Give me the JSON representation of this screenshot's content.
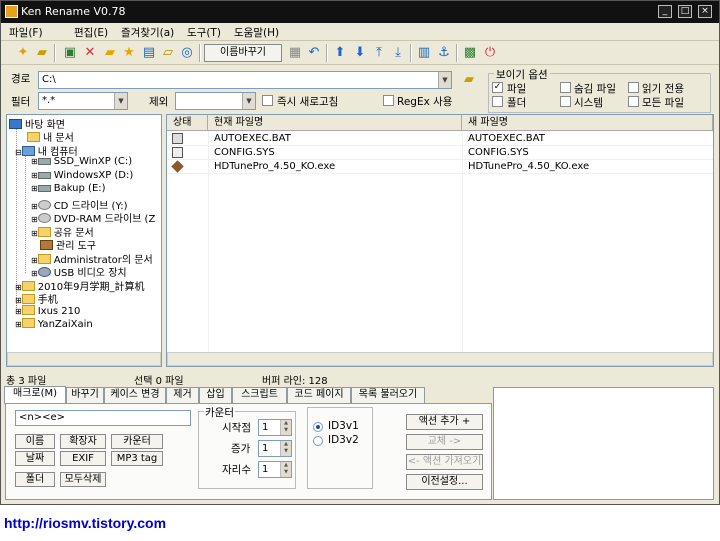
{
  "window": {
    "title": "Ken Rename V0.78"
  },
  "menu": [
    "파일(F)",
    "편집(E)",
    "즐겨찾기(a)",
    "도구(T)",
    "도움말(H)"
  ],
  "toolbar": {
    "rename_label": "이름바꾸기"
  },
  "path": {
    "label": "경로",
    "value": "C:\\"
  },
  "filter": {
    "label": "필터",
    "value": "*.*",
    "exclude_label": "제외",
    "exclude_value": "",
    "instant_refresh_label": "즉시 새로고침",
    "regex_label": "RegEx 사용"
  },
  "view_options": {
    "title": "보이기 옵션",
    "items": [
      {
        "label": "파일",
        "checked": true
      },
      {
        "label": "숨김 파일",
        "checked": false
      },
      {
        "label": "읽기 전용",
        "checked": false
      },
      {
        "label": "폴더",
        "checked": false
      },
      {
        "label": "시스템",
        "checked": false
      },
      {
        "label": "모든 파일",
        "checked": false
      }
    ]
  },
  "tree": [
    {
      "label": "바탕 화면",
      "icon": "desktop-icon"
    },
    {
      "label": "내 문서",
      "icon": "folder-icon"
    },
    {
      "label": "내 컴퓨터",
      "icon": "computer-icon"
    },
    {
      "label": "SSD_WinXP (C:)",
      "icon": "drive-icon"
    },
    {
      "label": "WindowsXP (D:)",
      "icon": "drive-icon"
    },
    {
      "label": "Bakup (E:)",
      "icon": "drive-icon"
    },
    {
      "label": "CD 드라이브 (Y:)",
      "icon": "cd-drive-icon"
    },
    {
      "label": "DVD-RAM 드라이브 (Z",
      "icon": "dvd-drive-icon"
    },
    {
      "label": "공유 문서",
      "icon": "folder-icon"
    },
    {
      "label": "관리 도구",
      "icon": "admin-tools-icon"
    },
    {
      "label": "Administrator의 문서",
      "icon": "folder-icon"
    },
    {
      "label": "USB 비디오 장치",
      "icon": "usb-video-icon"
    },
    {
      "label": "2010年9月学期_計算机",
      "icon": "folder-icon"
    },
    {
      "label": "手机",
      "icon": "folder-icon"
    },
    {
      "label": "Ixus 210",
      "icon": "folder-icon"
    },
    {
      "label": "YanZaiXain",
      "icon": "folder-icon"
    }
  ],
  "list": {
    "columns": [
      "상태",
      "현재 파일명",
      "새 파일명"
    ],
    "rows": [
      {
        "current": "AUTOEXEC.BAT",
        "new": "AUTOEXEC.BAT",
        "icon": "bat-file-icon"
      },
      {
        "current": "CONFIG.SYS",
        "new": "CONFIG.SYS",
        "icon": "sys-file-icon"
      },
      {
        "current": "HDTunePro_4.50_KO.exe",
        "new": "HDTunePro_4.50_KO.exe",
        "icon": "exe-file-icon"
      }
    ]
  },
  "status": {
    "total": "총 3 파일",
    "selected": "선택 0 파일",
    "buffer": "버퍼 라인: 128"
  },
  "tabs": [
    "매크로(M)",
    "바꾸기",
    "케이스 변경",
    "제거",
    "삽입",
    "스크립트",
    "코드 페이지",
    "목록 불러오기"
  ],
  "macro": {
    "value": "<n><e>",
    "buttons": [
      "이름",
      "확장자",
      "카운터",
      "날짜",
      "EXIF",
      "MP3 tag",
      "폴더",
      "모두삭제"
    ]
  },
  "counter": {
    "title": "카운터",
    "start_label": "시작점",
    "start_value": "1",
    "step_label": "증가",
    "step_value": "1",
    "digits_label": "자리수",
    "digits_value": "1"
  },
  "id3": {
    "v1": "ID3v1",
    "v2": "ID3v2"
  },
  "actions": {
    "add": "액션 추가 +",
    "replace": "교체 ->",
    "get": "<- 액션 가져오기",
    "previous": "이전설정..."
  },
  "footer": {
    "url": "http://riosmv.tistory.com"
  }
}
